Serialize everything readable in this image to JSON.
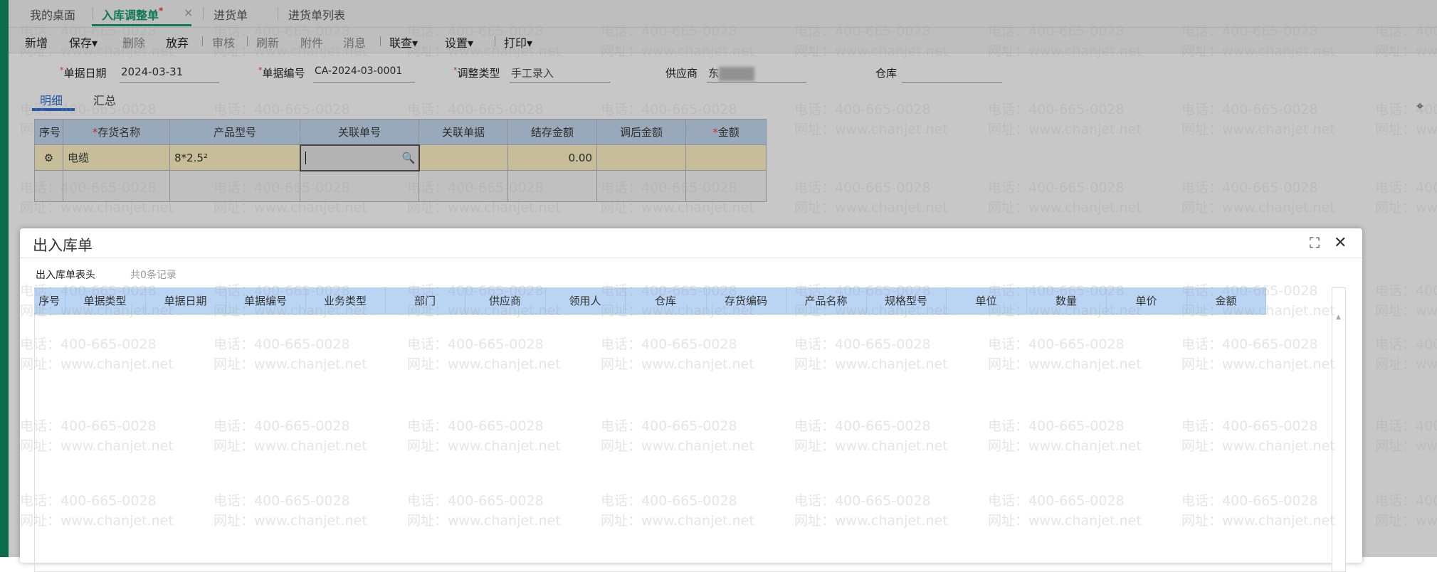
{
  "tabs": [
    {
      "label": "我的桌面"
    },
    {
      "label": "入库调整单",
      "modified": "*",
      "close": "×"
    },
    {
      "label": "进货单"
    },
    {
      "label": "进货单列表"
    }
  ],
  "toolbar": [
    "新增",
    "保存▾",
    "删除",
    "放弃",
    "审核",
    "刷新",
    "附件",
    "消息",
    "联查▾",
    "设置▾",
    "打印▾"
  ],
  "form": {
    "date_label": "单据日期",
    "date_value": "2024-03-31",
    "code_label": "单据编号",
    "code_value": "CA-2024-03-0001",
    "type_label": "调整类型",
    "type_value": "手工录入",
    "supplier_label": "供应商",
    "supplier_value": "东",
    "warehouse_label": "仓库",
    "warehouse_value": ""
  },
  "subtabs": [
    "明细",
    "汇总"
  ],
  "grid": {
    "headers": [
      "序号",
      "存货名称",
      "产品型号",
      "关联单号",
      "关联单据",
      "结存金额",
      "调后金额",
      "金额"
    ],
    "required": "*",
    "row": {
      "name": "电缆",
      "model": "8*2.5²",
      "balance": "0.00"
    }
  },
  "modal": {
    "title": "出入库单",
    "subtitle": "出入库单表头",
    "count": "共0条记录",
    "headers": [
      "序号",
      "单据类型",
      "单据日期",
      "单据编号",
      "业务类型",
      "部门",
      "供应商",
      "领用人",
      "仓库",
      "存货编码",
      "产品名称",
      "规格型号",
      "单位",
      "数量",
      "单价",
      "金额"
    ]
  },
  "watermark": {
    "phone": "电话：400-665-0028",
    "site": "网址：www.chanjet.net"
  }
}
